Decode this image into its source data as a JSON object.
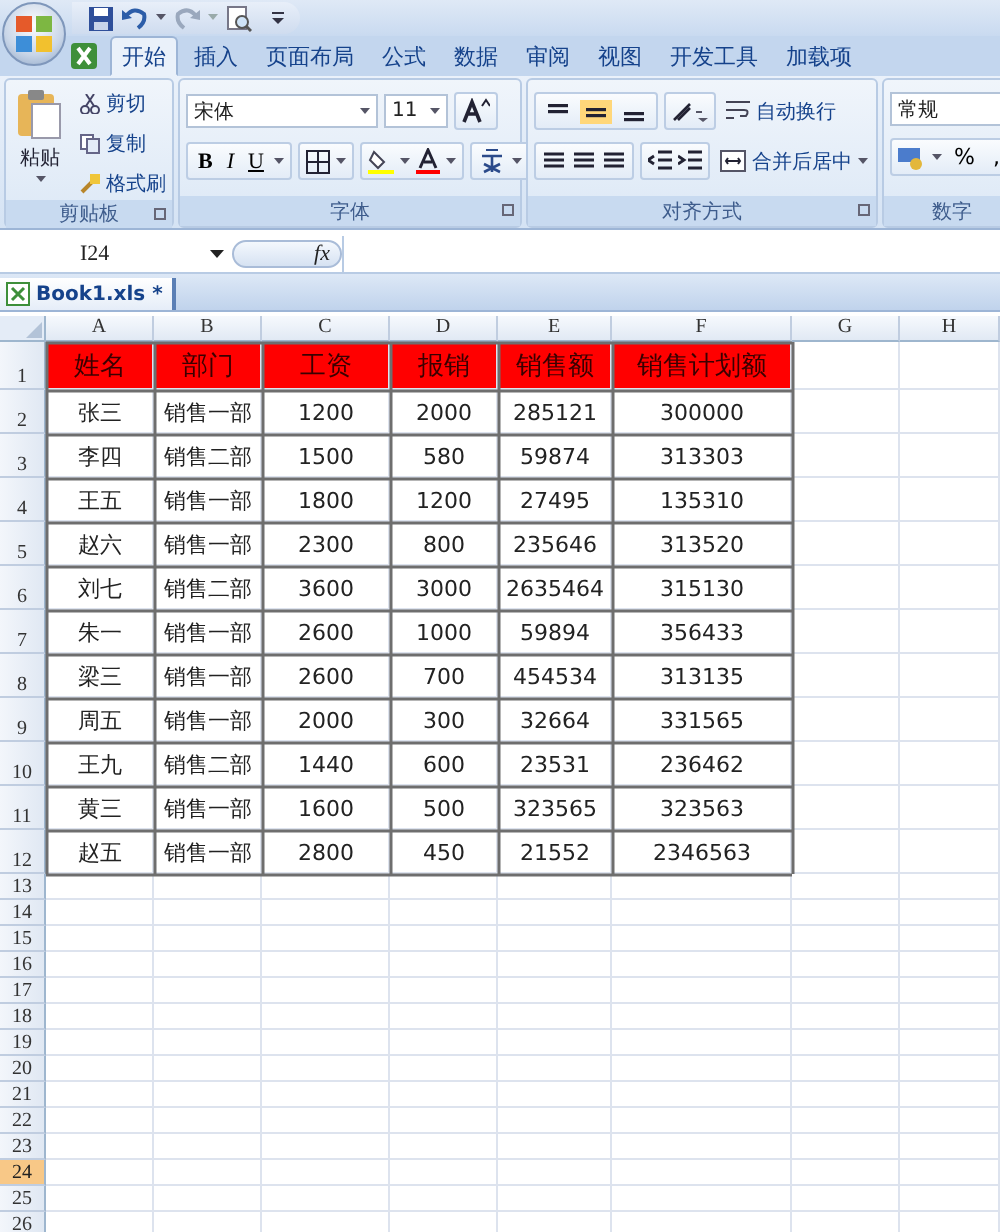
{
  "ribbon": {
    "tabs": [
      {
        "label": "开始",
        "selected": true
      },
      {
        "label": "插入",
        "selected": false
      },
      {
        "label": "页面布局",
        "selected": false
      },
      {
        "label": "公式",
        "selected": false
      },
      {
        "label": "数据",
        "selected": false
      },
      {
        "label": "审阅",
        "selected": false
      },
      {
        "label": "视图",
        "selected": false
      },
      {
        "label": "开发工具",
        "selected": false
      },
      {
        "label": "加载项",
        "selected": false
      }
    ],
    "clipboard": {
      "label": "剪贴板",
      "paste": "粘贴",
      "actions": [
        "剪切",
        "复制",
        "格式刷"
      ]
    },
    "font": {
      "label": "字体",
      "font_name": "宋体",
      "font_size": "11",
      "styles": [
        "B",
        "I",
        "U"
      ]
    },
    "alignment": {
      "label": "对齐方式",
      "vertical": [
        {
          "selected": false
        },
        {
          "selected": true
        },
        {
          "selected": false
        }
      ],
      "wrap": "自动换行",
      "merge": "合并后居中"
    },
    "number": {
      "label": "数字",
      "format": "常规",
      "percent": "%",
      "comma": ","
    }
  },
  "formula_bar": {
    "name_box": "I24",
    "fx": "fx"
  },
  "workbook_tab": "Book1.xls *",
  "sheet": {
    "columns": [
      "A",
      "B",
      "C",
      "D",
      "E",
      "F",
      "G",
      "H"
    ],
    "header": [
      "姓名",
      "部门",
      "工资",
      "报销",
      "销售额",
      "销售计划额"
    ],
    "rows": [
      [
        "张三",
        "销售一部",
        "1200",
        "2000",
        "285121",
        "300000"
      ],
      [
        "李四",
        "销售二部",
        "1500",
        "580",
        "59874",
        "313303"
      ],
      [
        "王五",
        "销售一部",
        "1800",
        "1200",
        "27495",
        "135310"
      ],
      [
        "赵六",
        "销售一部",
        "2300",
        "800",
        "235646",
        "313520"
      ],
      [
        "刘七",
        "销售二部",
        "3600",
        "3000",
        "2635464",
        "315130"
      ],
      [
        "朱一",
        "销售一部",
        "2600",
        "1000",
        "59894",
        "356433"
      ],
      [
        "梁三",
        "销售一部",
        "2600",
        "700",
        "454534",
        "313135"
      ],
      [
        "周五",
        "销售一部",
        "2000",
        "300",
        "32664",
        "331565"
      ],
      [
        "王九",
        "销售二部",
        "1440",
        "600",
        "23531",
        "236462"
      ],
      [
        "黄三",
        "销售一部",
        "1600",
        "500",
        "323565",
        "323563"
      ],
      [
        "赵五",
        "销售一部",
        "2800",
        "450",
        "21552",
        "2346563"
      ]
    ],
    "row_numbers": [
      {
        "label": "1",
        "selected": false
      },
      {
        "label": "2",
        "selected": false
      },
      {
        "label": "3",
        "selected": false
      },
      {
        "label": "4",
        "selected": false
      },
      {
        "label": "5",
        "selected": false
      },
      {
        "label": "6",
        "selected": false
      },
      {
        "label": "7",
        "selected": false
      },
      {
        "label": "8",
        "selected": false
      },
      {
        "label": "9",
        "selected": false
      },
      {
        "label": "10",
        "selected": false
      },
      {
        "label": "11",
        "selected": false
      },
      {
        "label": "12",
        "selected": false
      },
      {
        "label": "13",
        "selected": false
      },
      {
        "label": "14",
        "selected": false
      },
      {
        "label": "15",
        "selected": false
      },
      {
        "label": "16",
        "selected": false
      },
      {
        "label": "17",
        "selected": false
      },
      {
        "label": "18",
        "selected": false
      },
      {
        "label": "19",
        "selected": false
      },
      {
        "label": "20",
        "selected": false
      },
      {
        "label": "21",
        "selected": false
      },
      {
        "label": "22",
        "selected": false
      },
      {
        "label": "23",
        "selected": false
      },
      {
        "label": "24",
        "selected": true
      },
      {
        "label": "25",
        "selected": false
      },
      {
        "label": "26",
        "selected": false
      }
    ]
  }
}
